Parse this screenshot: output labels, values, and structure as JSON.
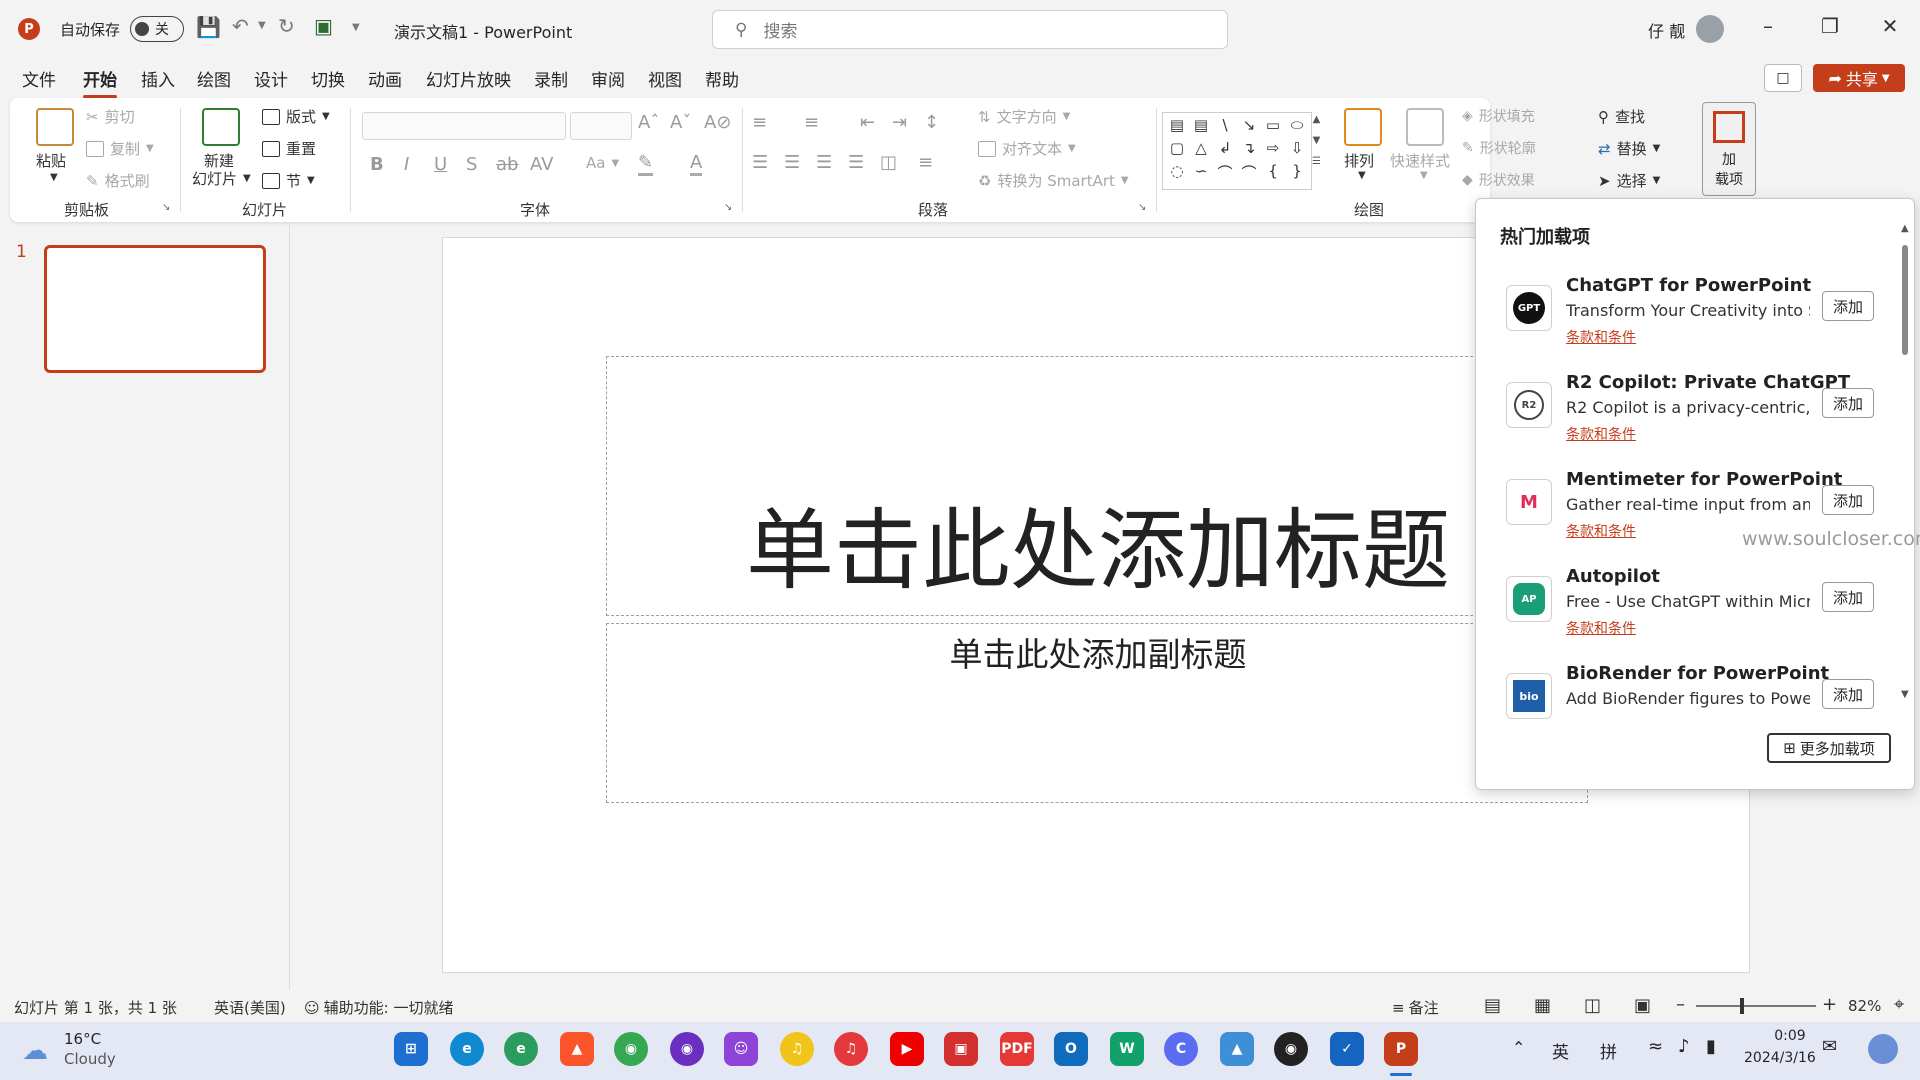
{
  "titlebar": {
    "app_logo": "P",
    "autosave_label": "自动保存",
    "autosave_state": "关",
    "doc_title": "演示文稿1 - PowerPoint",
    "search_placeholder": "搜索",
    "user_name": "仔 靓"
  },
  "menu": {
    "items": [
      "文件",
      "开始",
      "插入",
      "绘图",
      "设计",
      "切换",
      "动画",
      "幻灯片放映",
      "录制",
      "审阅",
      "视图",
      "帮助"
    ],
    "active": "开始",
    "share_label": "共享"
  },
  "ribbon": {
    "clipboard": {
      "paste": "粘贴",
      "cut": "剪切",
      "copy": "复制",
      "format_painter": "格式刷",
      "label": "剪贴板"
    },
    "slides": {
      "new_slide_1": "新建",
      "new_slide_2": "幻灯片",
      "layout": "版式",
      "reset": "重置",
      "section": "节",
      "label": "幻灯片"
    },
    "font": {
      "label": "字体",
      "case": "Aa"
    },
    "paragraph": {
      "text_direction": "文字方向",
      "align_text": "对齐文本",
      "smartart": "转换为 SmartArt",
      "label": "段落"
    },
    "drawing": {
      "arrange": "排列",
      "quick_styles": "快速样式",
      "shape_fill": "形状填充",
      "shape_outline": "形状轮廓",
      "shape_effects": "形状效果",
      "label": "绘图"
    },
    "editing": {
      "find": "查找",
      "replace": "替换",
      "select": "选择"
    },
    "addins": {
      "label_1": "加",
      "label_2": "载项"
    }
  },
  "slides_panel": {
    "thumb_number": "1"
  },
  "slide": {
    "title_placeholder": "单击此处添加标题",
    "subtitle_placeholder": "单击此处添加副标题"
  },
  "addins_panel": {
    "title": "热门加载项",
    "items": [
      {
        "name": "ChatGPT for PowerPoint",
        "desc": "Transform Your Creativity into S...",
        "terms": "条款和条件",
        "add": "添加",
        "icon": "GPT"
      },
      {
        "name": "R2 Copilot: Private ChatGPT",
        "desc": "R2 Copilot is a privacy-centric,...",
        "terms": "条款和条件",
        "add": "添加",
        "icon": "R2"
      },
      {
        "name": "Mentimeter for PowerPoint",
        "desc": "Gather real-time input from any...",
        "terms": "条款和条件",
        "add": "添加",
        "icon": "M"
      },
      {
        "name": "Autopilot",
        "desc": "Free - Use ChatGPT within Micr...",
        "terms": "条款和条件",
        "add": "添加",
        "icon": "AP"
      },
      {
        "name": "BioRender for PowerPoint",
        "desc": "Add BioRender figures to Powe...",
        "terms": "条款和条件",
        "add": "添加",
        "icon": "bio"
      }
    ],
    "more_button": "更多加载项"
  },
  "watermark": "www.soulcloser.com",
  "statusbar": {
    "slide_info": "幻灯片 第 1 张，共 1 张",
    "language": "英语(美国)",
    "accessibility": "辅助功能: 一切就绪",
    "notes": "备注",
    "zoom": "82%"
  },
  "taskbar": {
    "weather_temp": "16°C",
    "weather_desc": "Cloudy",
    "ime_1": "英",
    "ime_2": "拼",
    "time": "0:09",
    "date": "2024/3/16"
  },
  "colors": {
    "accent": "#c43e1c",
    "ribbon_bg": "#ffffff",
    "window_bg": "#f3f3f3"
  }
}
